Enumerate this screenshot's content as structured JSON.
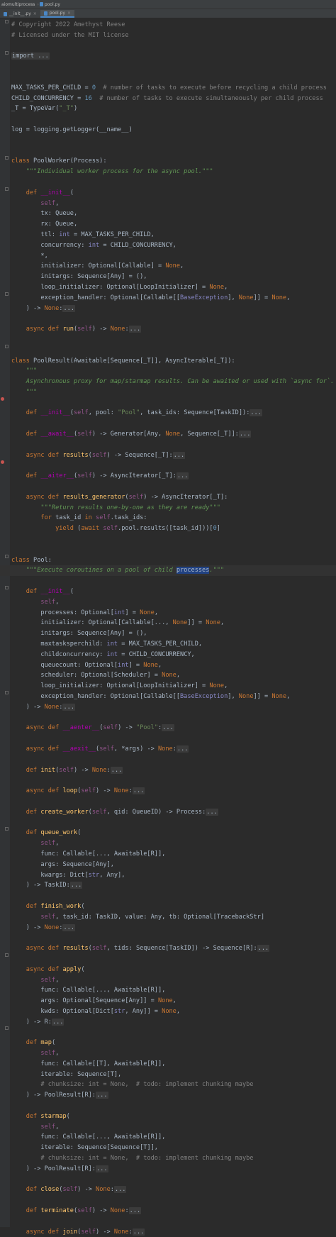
{
  "breadcrumb": [
    "aiomultiprocess",
    "pool.py"
  ],
  "tabs": [
    {
      "label": "__init__.py",
      "active": false
    },
    {
      "label": "pool.py",
      "active": true
    }
  ],
  "lines": [
    [
      [
        "cm",
        "# Copyright 2022 Amethyst Reese"
      ]
    ],
    [
      [
        "cm",
        "# Licensed under the MIT license"
      ]
    ],
    [],
    [
      [
        "fold",
        "import ..."
      ]
    ],
    [],
    [],
    [
      [
        "",
        "MAX_TASKS_PER_CHILD = "
      ],
      [
        "num",
        "0"
      ],
      [
        "cm",
        "  # number of tasks to execute before recycling a child process"
      ]
    ],
    [
      [
        "",
        "CHILD_CONCURRENCY = "
      ],
      [
        "num",
        "16"
      ],
      [
        "cm",
        "  # number of tasks to execute simultaneously per child process"
      ]
    ],
    [
      [
        "",
        "_T = TypeVar("
      ],
      [
        "str",
        "\"_T\""
      ],
      [
        "",
        ")"
      ]
    ],
    [],
    [
      [
        "",
        "log = logging.getLogger(__name__)"
      ]
    ],
    [],
    [],
    [
      [
        "kw",
        "class "
      ],
      [
        "",
        "PoolWorker(Process):"
      ]
    ],
    [
      [
        "doc",
        "    \"\"\"Individual worker process for the async pool.\"\"\""
      ]
    ],
    [],
    [
      [
        "kw",
        "    def "
      ],
      [
        "mg",
        "__init__"
      ],
      [
        "",
        "("
      ]
    ],
    [
      [
        "sf",
        "        self"
      ],
      [
        "",
        ","
      ]
    ],
    [
      [
        "",
        "        tx: Queue,"
      ]
    ],
    [
      [
        "",
        "        rx: Queue,"
      ]
    ],
    [
      [
        "",
        "        ttl: "
      ],
      [
        "bi",
        "int"
      ],
      [
        "",
        " = MAX_TASKS_PER_CHILD,"
      ]
    ],
    [
      [
        "",
        "        concurrency: "
      ],
      [
        "bi",
        "int"
      ],
      [
        "",
        " = CHILD_CONCURRENCY,"
      ]
    ],
    [
      [
        "",
        "        *,"
      ]
    ],
    [
      [
        "",
        "        initializer: Optional[Callable] = "
      ],
      [
        "kw",
        "None"
      ],
      [
        "",
        ","
      ]
    ],
    [
      [
        "",
        "        initargs: Sequence[Any] = (),"
      ]
    ],
    [
      [
        "",
        "        loop_initializer: Optional[LoopInitializer] = "
      ],
      [
        "kw",
        "None"
      ],
      [
        "",
        ","
      ]
    ],
    [
      [
        "",
        "        exception_handler: Optional[Callable[["
      ],
      [
        "bi",
        "BaseException"
      ],
      [
        "",
        "], "
      ],
      [
        "kw",
        "None"
      ],
      [
        "",
        "]] = "
      ],
      [
        "kw",
        "None"
      ],
      [
        "",
        ","
      ]
    ],
    [
      [
        "",
        "    ) -> "
      ],
      [
        "kw",
        "None"
      ],
      [
        "",
        ":"
      ],
      [
        "fold",
        "..."
      ]
    ],
    [],
    [
      [
        "kw",
        "    async def "
      ],
      [
        "fn",
        "run"
      ],
      [
        "",
        "("
      ],
      [
        "sf",
        "self"
      ],
      [
        "",
        ") -> "
      ],
      [
        "kw",
        "None"
      ],
      [
        "",
        ":"
      ],
      [
        "fold",
        "..."
      ]
    ],
    [],
    [],
    [
      [
        "kw",
        "class "
      ],
      [
        "",
        "PoolResult(Awaitable[Sequence[_T]], AsyncIterable[_T]):"
      ]
    ],
    [
      [
        "doc",
        "    \"\"\""
      ]
    ],
    [
      [
        "doc",
        "    Asynchronous proxy for map/starmap results. Can be awaited or used with `async for`."
      ]
    ],
    [
      [
        "doc",
        "    \"\"\""
      ]
    ],
    [],
    [
      [
        "kw",
        "    def "
      ],
      [
        "mg",
        "__init__"
      ],
      [
        "",
        "("
      ],
      [
        "sf",
        "self"
      ],
      [
        "",
        ", pool: "
      ],
      [
        "str",
        "\"Pool\""
      ],
      [
        "",
        ", task_ids: Sequence[TaskID]):"
      ],
      [
        "fold",
        "..."
      ]
    ],
    [],
    [
      [
        "kw",
        "    def "
      ],
      [
        "mg",
        "__await__"
      ],
      [
        "",
        "("
      ],
      [
        "sf",
        "self"
      ],
      [
        "",
        ") -> Generator[Any, "
      ],
      [
        "kw",
        "None"
      ],
      [
        "",
        ", Sequence[_T]]:"
      ],
      [
        "fold",
        "..."
      ]
    ],
    [],
    [
      [
        "kw",
        "    async def "
      ],
      [
        "fn",
        "results"
      ],
      [
        "",
        "("
      ],
      [
        "sf",
        "self"
      ],
      [
        "",
        ") -> Sequence[_T]:"
      ],
      [
        "fold",
        "..."
      ]
    ],
    [],
    [
      [
        "kw",
        "    def "
      ],
      [
        "mg",
        "__aiter__"
      ],
      [
        "",
        "("
      ],
      [
        "sf",
        "self"
      ],
      [
        "",
        ") -> AsyncIterator[_T]:"
      ],
      [
        "fold",
        "..."
      ]
    ],
    [],
    [
      [
        "kw",
        "    async def "
      ],
      [
        "fn",
        "results_generator"
      ],
      [
        "",
        "("
      ],
      [
        "sf",
        "self"
      ],
      [
        "",
        ") -> AsyncIterator[_T]:"
      ]
    ],
    [
      [
        "doc",
        "        \"\"\"Return results one-by-one as they are ready\"\"\""
      ]
    ],
    [
      [
        "kw",
        "        for "
      ],
      [
        "",
        "task_id "
      ],
      [
        "kw",
        "in "
      ],
      [
        "sf",
        "self"
      ],
      [
        "",
        ".task_ids:"
      ]
    ],
    [
      [
        "kw",
        "            yield "
      ],
      [
        "",
        "("
      ],
      [
        "kw",
        "await "
      ],
      [
        "sf",
        "self"
      ],
      [
        "",
        ".pool.results([task_id]))["
      ],
      [
        "num",
        "0"
      ],
      [
        "",
        "]"
      ]
    ],
    [],
    [],
    [
      [
        "kw",
        "class "
      ],
      [
        "",
        "Pool:"
      ]
    ],
    [
      [
        "doc",
        "    \"\"\"Execute coroutines on a pool of child "
      ],
      [
        "sel",
        "processes"
      ],
      [
        "doc",
        ".\"\"\""
      ]
    ],
    [],
    [
      [
        "kw",
        "    def "
      ],
      [
        "mg",
        "__init__"
      ],
      [
        "",
        "("
      ]
    ],
    [
      [
        "sf",
        "        self"
      ],
      [
        "",
        ","
      ]
    ],
    [
      [
        "",
        "        processes: Optional["
      ],
      [
        "bi",
        "int"
      ],
      [
        "",
        "] = "
      ],
      [
        "kw",
        "None"
      ],
      [
        "",
        ","
      ]
    ],
    [
      [
        "",
        "        initializer: Optional[Callable[..., "
      ],
      [
        "kw",
        "None"
      ],
      [
        "",
        "]] = "
      ],
      [
        "kw",
        "None"
      ],
      [
        "",
        ","
      ]
    ],
    [
      [
        "",
        "        initargs: Sequence[Any] = (),"
      ]
    ],
    [
      [
        "",
        "        maxtasksperchild: "
      ],
      [
        "bi",
        "int"
      ],
      [
        "",
        " = MAX_TASKS_PER_CHILD,"
      ]
    ],
    [
      [
        "",
        "        childconcurrency: "
      ],
      [
        "bi",
        "int"
      ],
      [
        "",
        " = CHILD_CONCURRENCY,"
      ]
    ],
    [
      [
        "",
        "        queuecount: Optional["
      ],
      [
        "bi",
        "int"
      ],
      [
        "",
        "] = "
      ],
      [
        "kw",
        "None"
      ],
      [
        "",
        ","
      ]
    ],
    [
      [
        "",
        "        scheduler: Optional[Scheduler] = "
      ],
      [
        "kw",
        "None"
      ],
      [
        "",
        ","
      ]
    ],
    [
      [
        "",
        "        loop_initializer: Optional[LoopInitializer] = "
      ],
      [
        "kw",
        "None"
      ],
      [
        "",
        ","
      ]
    ],
    [
      [
        "",
        "        exception_handler: Optional[Callable[["
      ],
      [
        "bi",
        "BaseException"
      ],
      [
        "",
        "], "
      ],
      [
        "kw",
        "None"
      ],
      [
        "",
        "]] = "
      ],
      [
        "kw",
        "None"
      ],
      [
        "",
        ","
      ]
    ],
    [
      [
        "",
        "    ) -> "
      ],
      [
        "kw",
        "None"
      ],
      [
        "",
        ":"
      ],
      [
        "fold",
        "..."
      ]
    ],
    [],
    [
      [
        "kw",
        "    async def "
      ],
      [
        "mg",
        "__aenter__"
      ],
      [
        "",
        "("
      ],
      [
        "sf",
        "self"
      ],
      [
        "",
        ") -> "
      ],
      [
        "str",
        "\"Pool\""
      ],
      [
        "",
        ":"
      ],
      [
        "fold",
        "..."
      ]
    ],
    [],
    [
      [
        "kw",
        "    async def "
      ],
      [
        "mg",
        "__aexit__"
      ],
      [
        "",
        "("
      ],
      [
        "sf",
        "self"
      ],
      [
        "",
        ", *args) -> "
      ],
      [
        "kw",
        "None"
      ],
      [
        "",
        ":"
      ],
      [
        "fold",
        "..."
      ]
    ],
    [],
    [
      [
        "kw",
        "    def "
      ],
      [
        "fn",
        "init"
      ],
      [
        "",
        "("
      ],
      [
        "sf",
        "self"
      ],
      [
        "",
        ") -> "
      ],
      [
        "kw",
        "None"
      ],
      [
        "",
        ":"
      ],
      [
        "fold",
        "..."
      ]
    ],
    [],
    [
      [
        "kw",
        "    async def "
      ],
      [
        "fn",
        "loop"
      ],
      [
        "",
        "("
      ],
      [
        "sf",
        "self"
      ],
      [
        "",
        ") -> "
      ],
      [
        "kw",
        "None"
      ],
      [
        "",
        ":"
      ],
      [
        "fold",
        "..."
      ]
    ],
    [],
    [
      [
        "kw",
        "    def "
      ],
      [
        "fn",
        "create_worker"
      ],
      [
        "",
        "("
      ],
      [
        "sf",
        "self"
      ],
      [
        "",
        ", qid: QueueID) -> Process:"
      ],
      [
        "fold",
        "..."
      ]
    ],
    [],
    [
      [
        "kw",
        "    def "
      ],
      [
        "fn",
        "queue_work"
      ],
      [
        "",
        "("
      ]
    ],
    [
      [
        "sf",
        "        self"
      ],
      [
        "",
        ","
      ]
    ],
    [
      [
        "",
        "        func: Callable[..., Awaitable[R]],"
      ]
    ],
    [
      [
        "",
        "        args: Sequence[Any],"
      ]
    ],
    [
      [
        "",
        "        kwargs: Dict["
      ],
      [
        "bi",
        "str"
      ],
      [
        "",
        ", Any],"
      ]
    ],
    [
      [
        "",
        "    ) -> TaskID:"
      ],
      [
        "fold",
        "..."
      ]
    ],
    [],
    [
      [
        "kw",
        "    def "
      ],
      [
        "fn",
        "finish_work"
      ],
      [
        "",
        "("
      ]
    ],
    [
      [
        "sf",
        "        self"
      ],
      [
        "",
        ", task_id: TaskID, value: Any, tb: Optional[TracebackStr]"
      ]
    ],
    [
      [
        "",
        "    ) -> "
      ],
      [
        "kw",
        "None"
      ],
      [
        "",
        ":"
      ],
      [
        "fold",
        "..."
      ]
    ],
    [],
    [
      [
        "kw",
        "    async def "
      ],
      [
        "fn",
        "results"
      ],
      [
        "",
        "("
      ],
      [
        "sf",
        "self"
      ],
      [
        "",
        ", tids: Sequence[TaskID]) -> Sequence[R]:"
      ],
      [
        "fold",
        "..."
      ]
    ],
    [],
    [
      [
        "kw",
        "    async def "
      ],
      [
        "fn",
        "apply"
      ],
      [
        "",
        "("
      ]
    ],
    [
      [
        "sf",
        "        self"
      ],
      [
        "",
        ","
      ]
    ],
    [
      [
        "",
        "        func: Callable[..., Awaitable[R]],"
      ]
    ],
    [
      [
        "",
        "        args: Optional[Sequence[Any]] = "
      ],
      [
        "kw",
        "None"
      ],
      [
        "",
        ","
      ]
    ],
    [
      [
        "",
        "        kwds: Optional[Dict["
      ],
      [
        "bi",
        "str"
      ],
      [
        "",
        ", Any]] = "
      ],
      [
        "kw",
        "None"
      ],
      [
        "",
        ","
      ]
    ],
    [
      [
        "",
        "    ) -> R:"
      ],
      [
        "fold",
        "..."
      ]
    ],
    [],
    [
      [
        "kw",
        "    def "
      ],
      [
        "fn",
        "map"
      ],
      [
        "",
        "("
      ]
    ],
    [
      [
        "sf",
        "        self"
      ],
      [
        "",
        ","
      ]
    ],
    [
      [
        "",
        "        func: Callable[[T], Awaitable[R]],"
      ]
    ],
    [
      [
        "",
        "        iterable: Sequence[T],"
      ]
    ],
    [
      [
        "cm",
        "        # chunksize: int = None,  # todo: implement chunking maybe"
      ]
    ],
    [
      [
        "",
        "    ) -> PoolResult[R]:"
      ],
      [
        "fold",
        "..."
      ]
    ],
    [],
    [
      [
        "kw",
        "    def "
      ],
      [
        "fn",
        "starmap"
      ],
      [
        "",
        "("
      ]
    ],
    [
      [
        "sf",
        "        self"
      ],
      [
        "",
        ","
      ]
    ],
    [
      [
        "",
        "        func: Callable[..., Awaitable[R]],"
      ]
    ],
    [
      [
        "",
        "        iterable: Sequence[Sequence[T]],"
      ]
    ],
    [
      [
        "cm",
        "        # chunksize: int = None,  # todo: implement chunking maybe"
      ]
    ],
    [
      [
        "",
        "    ) -> PoolResult[R]:"
      ],
      [
        "fold",
        "..."
      ]
    ],
    [],
    [
      [
        "kw",
        "    def "
      ],
      [
        "fn",
        "close"
      ],
      [
        "",
        "("
      ],
      [
        "sf",
        "self"
      ],
      [
        "",
        ") -> "
      ],
      [
        "kw",
        "None"
      ],
      [
        "",
        ":"
      ],
      [
        "fold",
        "..."
      ]
    ],
    [],
    [
      [
        "kw",
        "    def "
      ],
      [
        "fn",
        "terminate"
      ],
      [
        "",
        "("
      ],
      [
        "sf",
        "self"
      ],
      [
        "",
        ") -> "
      ],
      [
        "kw",
        "None"
      ],
      [
        "",
        ":"
      ],
      [
        "fold",
        "..."
      ]
    ],
    [],
    [
      [
        "kw",
        "    async def "
      ],
      [
        "fn",
        "join"
      ],
      [
        "",
        "("
      ],
      [
        "sf",
        "self"
      ],
      [
        "",
        ") -> "
      ],
      [
        "kw",
        "None"
      ],
      [
        "",
        ":"
      ],
      [
        "fold",
        "..."
      ]
    ]
  ]
}
